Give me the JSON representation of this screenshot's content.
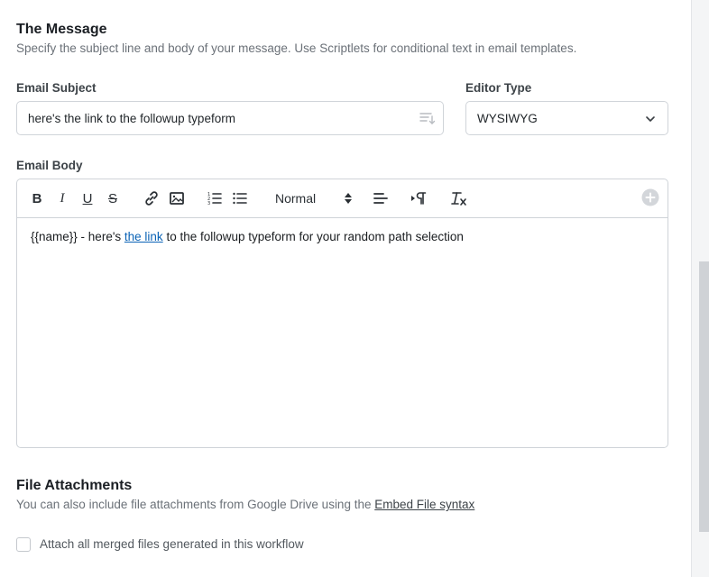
{
  "message": {
    "title": "The Message",
    "description": "Specify the subject line and body of your message. Use Scriptlets for conditional text in email templates."
  },
  "email_subject": {
    "label": "Email Subject",
    "value": "here's the link to the followup typeform"
  },
  "editor_type": {
    "label": "Editor Type",
    "value": "WYSIWYG"
  },
  "email_body": {
    "label": "Email Body",
    "toolbar": {
      "bold": "B",
      "italic": "I",
      "underline": "U",
      "strike": "S",
      "size": "Normal"
    },
    "content": {
      "before": "{{name}} - here's ",
      "link": "the link",
      "after": " to the followup typeform for your random path selection"
    }
  },
  "attachments": {
    "title": "File Attachments",
    "description": "You can also include file attachments from Google Drive using the ",
    "link": "Embed File syntax",
    "checkbox_label": "Attach all merged files generated in this workflow",
    "checkbox_checked": false
  },
  "icons": {
    "subject_helper": "list-sort-icon",
    "select_caret": "chevron-down-icon",
    "add": "plus-circle-icon"
  },
  "colors": {
    "link": "#0b63b6",
    "border": "#d0d4d9",
    "label": "#3d4348",
    "muted": "#6b7178"
  }
}
